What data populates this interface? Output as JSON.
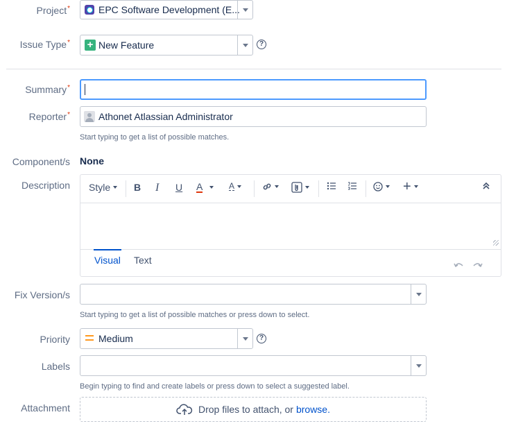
{
  "project": {
    "label": "Project",
    "required_mark": "*",
    "value": "EPC Software Development (E..."
  },
  "issue_type": {
    "label": "Issue Type",
    "required_mark": "*",
    "value": "New Feature",
    "help": "?"
  },
  "summary": {
    "label": "Summary",
    "required_mark": "*",
    "value": ""
  },
  "reporter": {
    "label": "Reporter",
    "required_mark": "*",
    "value": "Athonet Atlassian Administrator",
    "hint": "Start typing to get a list of possible matches."
  },
  "components": {
    "label": "Component/s",
    "value": "None"
  },
  "description": {
    "label": "Description",
    "toolbar": {
      "style_label": "Style",
      "bold": "B",
      "italic": "I",
      "underline": "U",
      "text_color": "A",
      "more_format": "A",
      "plus": "+"
    },
    "tabs": [
      "Visual",
      "Text"
    ],
    "active_tab": "Visual"
  },
  "fix_versions": {
    "label": "Fix Version/s",
    "value": "",
    "hint": "Start typing to get a list of possible matches or press down to select."
  },
  "priority": {
    "label": "Priority",
    "value": "Medium",
    "help": "?"
  },
  "labels": {
    "label": "Labels",
    "value": "",
    "hint": "Begin typing to find and create labels or press down to select a suggested label."
  },
  "attachment": {
    "label": "Attachment",
    "drop_text": "Drop files to attach, or",
    "browse_link": "browse."
  },
  "colors": {
    "accent": "#0052cc",
    "required": "#de350b",
    "priority_medium": "#ff991f",
    "issue_type_green": "#36b37e"
  }
}
